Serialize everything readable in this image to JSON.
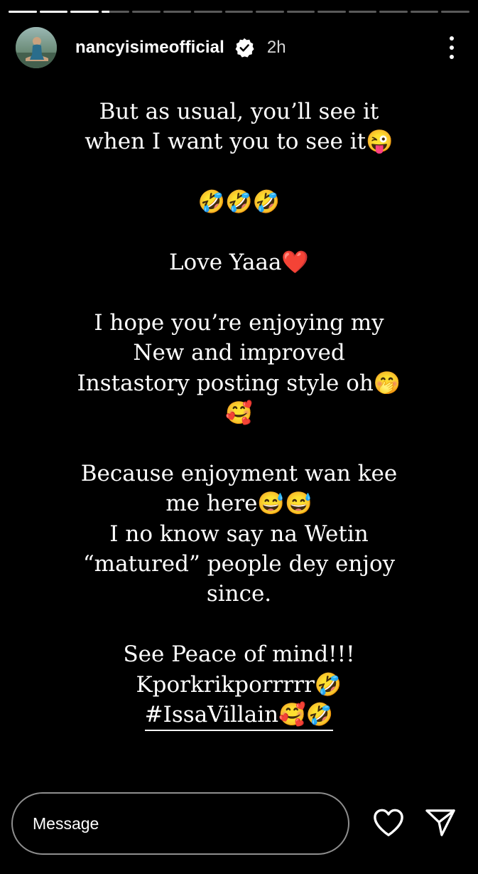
{
  "progress": {
    "segments": [
      1,
      1,
      1,
      0.3,
      0,
      0,
      0,
      0,
      0,
      0,
      0,
      0,
      0,
      0,
      0
    ]
  },
  "header": {
    "username": "nancyisimeofficial",
    "time": "2h",
    "verified": true,
    "avatar_icon": "profile-photo",
    "more_icon": "more-vertical-icon"
  },
  "story": {
    "lines": [
      "But as usual, you’ll see it",
      "when I want you to see it😜",
      "",
      "🤣🤣🤣",
      "",
      "Love Yaaa❤️",
      "",
      "I hope you’re enjoying my",
      "New and improved",
      "Instastory posting style oh🤭",
      "🥰",
      "",
      "Because enjoyment wan kee",
      "me here😅😅",
      "I no know say na Wetin",
      "“matured” people dey enjoy",
      "since.",
      "",
      "See Peace of mind!!!",
      "Kporkrikporrrrr🤣"
    ],
    "hashtag": "#IssaVillain🥰🤣"
  },
  "footer": {
    "message_placeholder": "Message",
    "like_icon": "heart-icon",
    "send_icon": "send-icon"
  },
  "colors": {
    "background": "#000000",
    "text": "#ffffff",
    "input_border": "#8e8e8e"
  }
}
